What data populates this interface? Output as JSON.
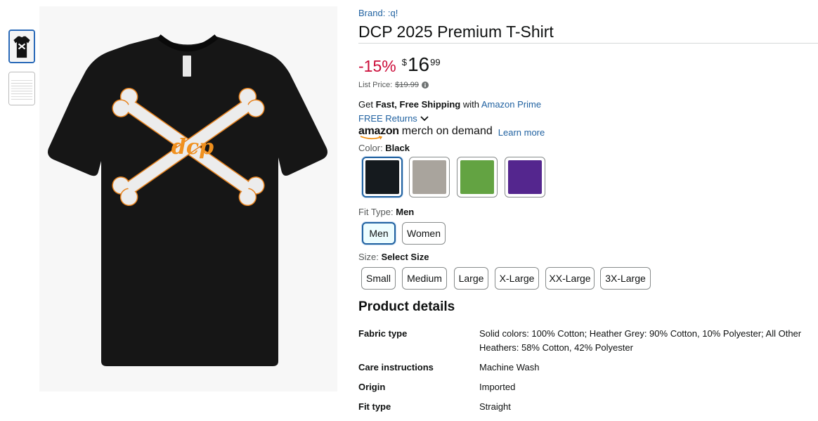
{
  "thumbnails": [
    {
      "name": "thumbnail-shirt"
    },
    {
      "name": "thumbnail-size-chart"
    }
  ],
  "product_image": {
    "logo_text": "dcp"
  },
  "brand": "Brand: :q!",
  "title": "DCP 2025 Premium T-Shirt",
  "price": {
    "discount": "-15%",
    "symbol": "$",
    "whole": "16",
    "fraction": "99",
    "list_label": "List Price:",
    "list_value": "$19.99"
  },
  "shipping": {
    "get": "Get ",
    "fast_free": "Fast, Free Shipping",
    "with": " with ",
    "prime_link": "Amazon Prime",
    "returns": "FREE Returns"
  },
  "merch": {
    "amazon": "amazon",
    "mod": "merch on demand",
    "learn_more": "Learn more"
  },
  "color": {
    "label": "Color: ",
    "selected": "Black",
    "swatches": [
      {
        "name": "Black",
        "hex": "#151a1e"
      },
      {
        "name": "Heather Grey",
        "hex": "#a9a49d"
      },
      {
        "name": "Green",
        "hex": "#63a342"
      },
      {
        "name": "Purple",
        "hex": "#54268e"
      }
    ]
  },
  "fit": {
    "label": "Fit Type: ",
    "selected": "Men",
    "options": [
      "Men",
      "Women"
    ]
  },
  "size": {
    "label": "Size: ",
    "selected": "Select Size",
    "options": [
      "Small",
      "Medium",
      "Large",
      "X-Large",
      "XX-Large",
      "3X-Large"
    ]
  },
  "product_details": {
    "heading": "Product details",
    "rows": [
      {
        "key": "Fabric type",
        "value": "Solid colors: 100% Cotton; Heather Grey: 90% Cotton, 10% Polyester; All Other Heathers: 58% Cotton, 42% Polyester"
      },
      {
        "key": "Care instructions",
        "value": "Machine Wash"
      },
      {
        "key": "Origin",
        "value": "Imported"
      },
      {
        "key": "Fit type",
        "value": "Straight"
      }
    ]
  },
  "colors": {
    "link": "#2162a1",
    "deal": "#cc0c39",
    "selected_border": "#2162a1"
  }
}
